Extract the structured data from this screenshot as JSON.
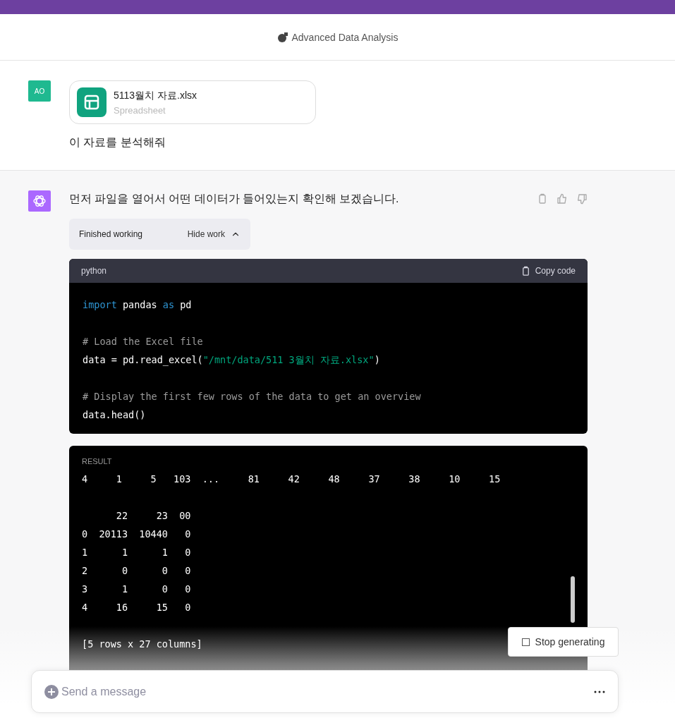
{
  "header": {
    "title": "Advanced Data Analysis"
  },
  "user_message": {
    "avatar": "AO",
    "attachment": {
      "name": "5113월치 자료.xlsx",
      "type": "Spreadsheet"
    },
    "text": "이 자료를 분석해줘"
  },
  "assistant_message": {
    "text": "먼저 파일을 열어서 어떤 데이터가 들어있는지 확인해 보겠습니다.",
    "work": {
      "status": "Finished working",
      "toggle": "Hide work",
      "expanded": true
    },
    "code": {
      "language": "python",
      "copy": "Copy code",
      "lines": [
        {
          "gap": false,
          "tokens": [
            {
              "kind": "keyword",
              "text": "import"
            },
            {
              "kind": "plain",
              "text": " pandas "
            },
            {
              "kind": "keyword",
              "text": "as"
            },
            {
              "kind": "plain",
              "text": " pd"
            }
          ]
        },
        {
          "gap": true,
          "tokens": [
            {
              "kind": "comment",
              "text": "# Load the Excel file"
            }
          ]
        },
        {
          "gap": false,
          "tokens": [
            {
              "kind": "plain",
              "text": "data = pd.read_excel("
            },
            {
              "kind": "string",
              "text": "\"/mnt/data/511 3월치 자료.xlsx\""
            },
            {
              "kind": "plain",
              "text": ")"
            }
          ]
        },
        {
          "gap": true,
          "tokens": [
            {
              "kind": "comment",
              "text": "# Display the first few rows of the data to get an overview"
            }
          ]
        },
        {
          "gap": false,
          "tokens": [
            {
              "kind": "plain",
              "text": "data.head()"
            }
          ]
        }
      ]
    },
    "result": {
      "label": "RESULT",
      "lines": [
        {
          "gap": false,
          "text": "4     1     5   103  ...     81     42     48     37     38     10     15"
        },
        {
          "gap": true,
          "text": "      22     23  00"
        },
        {
          "gap": false,
          "text": "0  20113  10440   0"
        },
        {
          "gap": false,
          "text": "1      1      1   0"
        },
        {
          "gap": false,
          "text": "2      0      0   0"
        },
        {
          "gap": false,
          "text": "3      1      0   0"
        },
        {
          "gap": false,
          "text": "4     16     15   0"
        },
        {
          "gap": true,
          "text": "[5 rows x 27 columns]"
        }
      ]
    }
  },
  "stop_button": "Stop generating",
  "composer": {
    "placeholder": "Send a message"
  }
}
